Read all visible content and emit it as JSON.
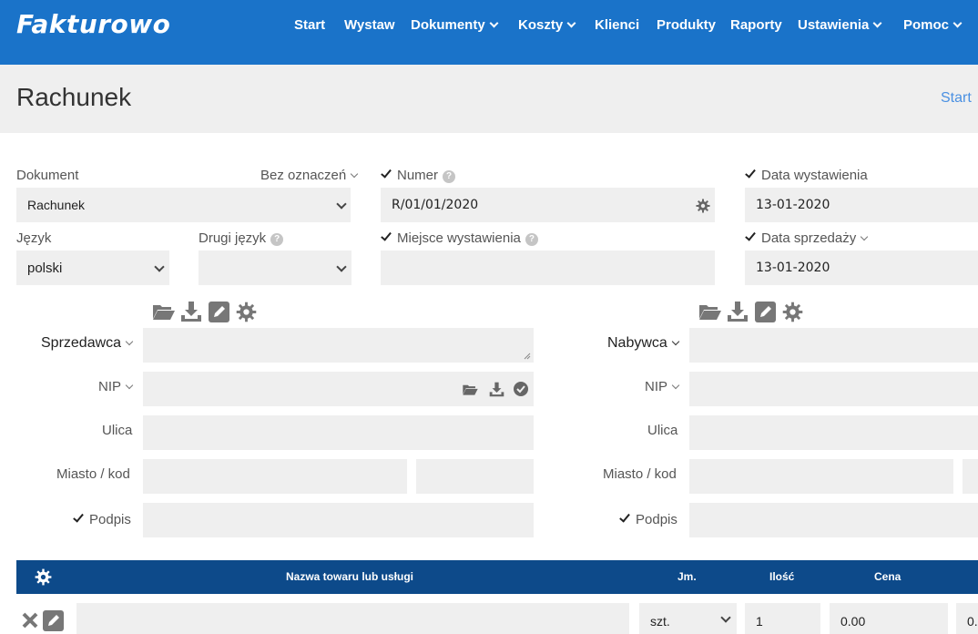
{
  "app": {
    "logo": "Fakturowo"
  },
  "nav": [
    {
      "label": "Start",
      "dropdown": false
    },
    {
      "label": "Wystaw",
      "dropdown": false
    },
    {
      "label": "Dokumenty",
      "dropdown": true
    },
    {
      "label": "Koszty",
      "dropdown": true
    },
    {
      "label": "Klienci",
      "dropdown": false
    },
    {
      "label": "Produkty",
      "dropdown": false
    },
    {
      "label": "Raporty",
      "dropdown": false
    },
    {
      "label": "Ustawienia",
      "dropdown": true
    },
    {
      "label": "Pomoc",
      "dropdown": true
    }
  ],
  "page": {
    "title": "Rachunek",
    "breadcrumb": "Start"
  },
  "form": {
    "dokument_label": "Dokument",
    "oznaczenie_label": "Bez oznaczeń",
    "dokument_value": "Rachunek",
    "jezyk_label": "Język",
    "jezyk_value": "polski",
    "drugi_jezyk_label": "Drugi język",
    "drugi_jezyk_value": "",
    "numer_label": "Numer",
    "numer_value": "R/01/01/2020",
    "miejsce_label": "Miejsce wystawienia",
    "miejsce_value": "",
    "data_wystawienia_label": "Data wystawienia",
    "data_wystawienia_value": "13-01-2020",
    "data_sprzedazy_label": "Data sprzedaży",
    "data_sprzedazy_value": "13-01-2020"
  },
  "seller": {
    "label": "Sprzedawca",
    "nip_label": "NIP",
    "ulica_label": "Ulica",
    "miasto_label": "Miasto / kod",
    "podpis_label": "Podpis"
  },
  "buyer": {
    "label": "Nabywca",
    "nip_label": "NIP",
    "ulica_label": "Ulica",
    "miasto_label": "Miasto / kod",
    "podpis_label": "Podpis"
  },
  "table": {
    "headers": [
      "Nazwa towaru lub usługi",
      "Jm.",
      "Ilość",
      "Cena"
    ],
    "row": {
      "name": "",
      "unit": "szt.",
      "qty": "1",
      "price": "0.00",
      "next": "0."
    }
  },
  "colors": {
    "topbar": "#1a73c9",
    "table_header": "#0d4a8a",
    "field_bg": "#efefef",
    "link": "#4a90e2"
  }
}
